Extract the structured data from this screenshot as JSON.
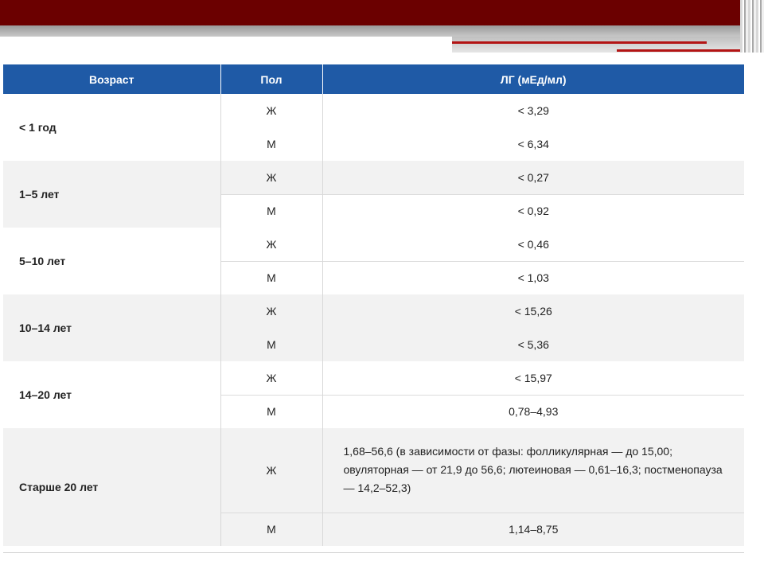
{
  "table": {
    "headers": {
      "age": "Возраст",
      "sex": "Пол",
      "lh": "ЛГ (мЕд/мл)"
    },
    "rows": [
      {
        "age": "< 1 год",
        "female": {
          "sex": "Ж",
          "value": "< 3,29"
        },
        "male": {
          "sex": "М",
          "value": "< 6,34"
        }
      },
      {
        "age": "1–5 лет",
        "female": {
          "sex": "Ж",
          "value": "< 0,27"
        },
        "male": {
          "sex": "М",
          "value": "< 0,92"
        }
      },
      {
        "age": "5–10 лет",
        "female": {
          "sex": "Ж",
          "value": "< 0,46"
        },
        "male": {
          "sex": "М",
          "value": "< 1,03"
        }
      },
      {
        "age": "10–14 лет",
        "female": {
          "sex": "Ж",
          "value": "< 15,26"
        },
        "male": {
          "sex": "М",
          "value": "< 5,36"
        }
      },
      {
        "age": "14–20 лет",
        "female": {
          "sex": "Ж",
          "value": "< 15,97"
        },
        "male": {
          "sex": "М",
          "value": "0,78–4,93"
        }
      },
      {
        "age": "Старше 20 лет",
        "female": {
          "sex": "Ж",
          "value": "1,68–56,6 (в зависимости от фазы: фолликулярная — до 15,00; овуляторная — от 21,9 до 56,6; лютеиновая — 0,61–16,3; постменопауза — 14,2–52,3)"
        },
        "male": {
          "sex": "М",
          "value": "1,14–8,75"
        }
      }
    ]
  },
  "colors": {
    "header_bar": "#6b0000",
    "table_header": "#1f5aa6",
    "accent_line": "#b31414",
    "row_shade": "#f2f2f2"
  }
}
